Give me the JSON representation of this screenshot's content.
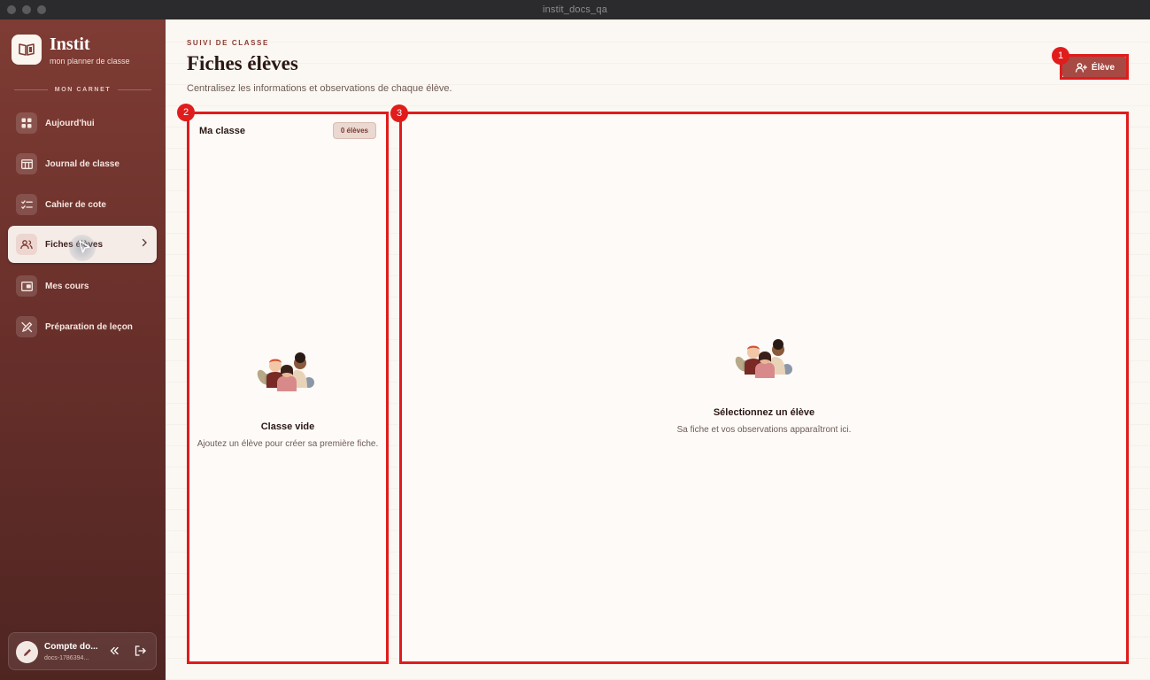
{
  "window": {
    "title": "instit_docs_qa"
  },
  "brand": {
    "name": "Instit",
    "tagline": "mon planner de classe"
  },
  "sidebar": {
    "section_label": "MON CARNET",
    "items": [
      {
        "label": "Aujourd'hui",
        "icon": "grid-icon"
      },
      {
        "label": "Journal de classe",
        "icon": "calendar-icon"
      },
      {
        "label": "Cahier de cote",
        "icon": "checklist-icon"
      },
      {
        "label": "Fiches élèves",
        "icon": "users-icon",
        "active": true
      },
      {
        "label": "Mes cours",
        "icon": "folder-icon"
      },
      {
        "label": "Préparation de leçon",
        "icon": "pencil-ruler-icon"
      }
    ]
  },
  "account": {
    "name": "Compte do...",
    "id": "docs-1786394..."
  },
  "header": {
    "eyebrow": "SUIVI DE CLASSE",
    "title": "Fiches élèves",
    "subtitle": "Centralisez les informations et observations de chaque élève.",
    "add_button": "Élève"
  },
  "class_panel": {
    "title": "Ma classe",
    "count": "0 élèves",
    "empty_title": "Classe vide",
    "empty_desc": "Ajoutez un élève pour créer sa première fiche."
  },
  "detail_panel": {
    "empty_title": "Sélectionnez un élève",
    "empty_desc": "Sa fiche et vos observations apparaîtront ici."
  },
  "annotations": [
    "1",
    "2",
    "3"
  ],
  "colors": {
    "accent": "#a64a43",
    "sidebar": "#6a302b",
    "highlight": "#e01c1c"
  }
}
